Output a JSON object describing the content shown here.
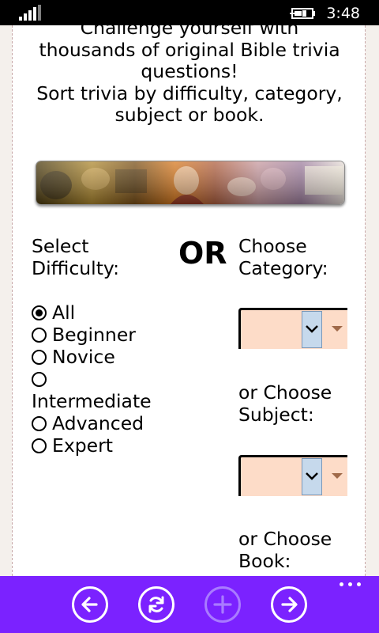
{
  "status_bar": {
    "time": "3:48"
  },
  "intro": {
    "lines": [
      "Challenge yourself with",
      "thousands of original Bible trivia",
      "questions!",
      "Sort trivia by difficulty, category,",
      "subject or book."
    ]
  },
  "difficulty": {
    "label_line1": "Select",
    "label_line2": "Difficulty:",
    "options": [
      "All",
      "Beginner",
      "Novice",
      "Intermediate",
      "Advanced",
      "Expert"
    ],
    "selected": "All"
  },
  "or_label": "OR",
  "category": {
    "label_line1": "Choose",
    "label_line2": "Category:"
  },
  "subject": {
    "label_line1": "or Choose",
    "label_line2": "Subject:"
  },
  "book": {
    "label_line1": "or Choose",
    "label_line2": "Book:"
  },
  "colors": {
    "app_bar": "#7b22ff",
    "select_bg": "#fddcc8",
    "select_button": "#c6d9ec"
  },
  "app_bar_icons": [
    "back-arrow-icon",
    "refresh-icon",
    "add-icon",
    "forward-arrow-icon",
    "more-dots-icon"
  ]
}
